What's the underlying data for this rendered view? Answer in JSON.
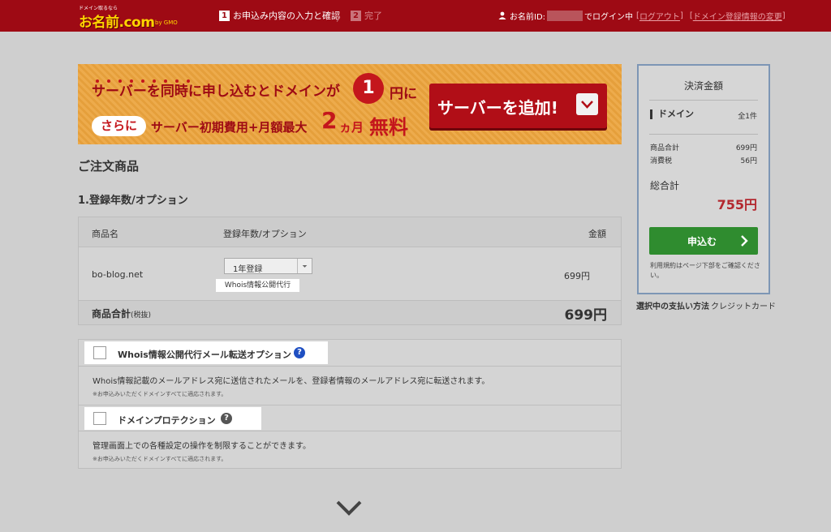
{
  "header": {
    "logo_tagline": "ドメイン取るなら",
    "logo_main": "お名前.com",
    "logo_sub": "by GMO",
    "step1_num": "1",
    "step1_label": "お申込み内容の入力と確認",
    "step2_num": "2",
    "step2_label": "完了",
    "user_id_label": "お名前ID:",
    "logged_in_text": "でログイン中",
    "logout_link": "ログアウト",
    "domain_info_link": "ドメイン登録情報の変更"
  },
  "banner": {
    "line1": "サーバーを同時に申し込むとドメインが",
    "price_num": "1",
    "price_unit": "円に",
    "sarani": "さらに",
    "line2": "サーバー初期費用+月額最大",
    "months_num": "2",
    "months_unit": "ヵ月",
    "free": "無料",
    "add_server_button": "サーバーを追加!"
  },
  "order": {
    "title": "ご注文商品",
    "section1_title": "1.登録年数/オプション",
    "table": {
      "col_name": "商品名",
      "col_option": "登録年数/オプション",
      "col_price": "金額",
      "domain": "bo-blog.net",
      "year_selected": "1年登録",
      "whois_tag": "Whois情報公開代行",
      "price": "699円",
      "total_label": "商品合計",
      "total_tax": "(税抜)",
      "total_price": "699円"
    }
  },
  "options": [
    {
      "title": "Whois情報公開代行メール転送オプション",
      "help_color": "#1f4fc2",
      "description": "Whois情報記載のメールアドレス宛に送信されたメールを、登録者情報のメールアドレス宛に転送されます。",
      "note": "※お申込みいただくドメインすべてに適応されます。"
    },
    {
      "title": "ドメインプロテクション",
      "help_color": "#555555",
      "description": "管理画面上での各種設定の操作を制限することができます。",
      "note": "※お申込みいただくドメインすべてに適応されます。"
    }
  ],
  "sidebar": {
    "title": "決済金額",
    "domain_label": "ドメイン",
    "domain_count": "全1件",
    "subtotal_label": "商品合計",
    "subtotal_value": "699円",
    "tax_label": "消費税",
    "tax_value": "56円",
    "total_label": "総合計",
    "total_value": "755円",
    "apply_button": "申込む",
    "note": "利用規約はページ下部をご確認ください。",
    "payment_label": "選択中の支払い方法",
    "payment_value": "クレジットカード"
  }
}
